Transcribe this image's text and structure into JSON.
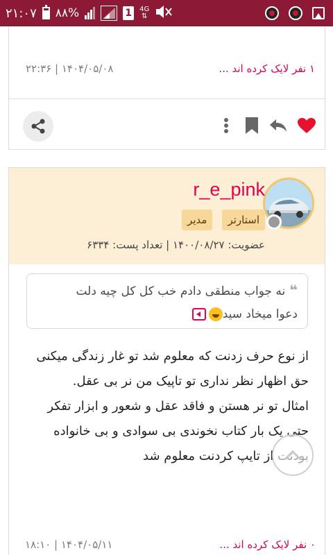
{
  "status_bar": {
    "time": "۲۱:۰۷",
    "battery_percent": "۸۸%",
    "sim_slot": "1",
    "network": "4G"
  },
  "post1": {
    "likes_text": "۱ نفر لایک کرده اند ...",
    "date": "۲۲:۳۶ | ۱۴۰۴/۰۵/۰۸"
  },
  "post2": {
    "username": "r_e_pink",
    "badges": [
      "استارتر",
      "مدیر"
    ],
    "member_info": "عضویت: ۱۴۰۰/۰۸/۲۷ | تعداد پست: ۶۳۳۴",
    "quote": {
      "line1": "نه جواب منطقی دادم خب کل کل چیه دلت",
      "line2": "دعوا میخاد سید"
    },
    "body_lines": [
      "از نوع حرف زدنت که معلوم شد تو غار زندگی میکنی",
      "حق اظهار نظر نداری تو تاپیک من نر بی عقل.",
      "امثال تو نر هستن و فاقد عقل و شعور و ابزار تفکر",
      "حتی یک بار کتاب نخوندی بی سوادی و بی خانواده بودنت از تایپ کردنت معلوم شد"
    ],
    "likes_text": "۰ نفر لایک کرده اند ...",
    "date": "۱۸:۱۰ | ۱۴۰۴/۰۵/۱۱"
  },
  "colors": {
    "status_bar": "#8c1a36",
    "accent_pink": "#e4004f",
    "header_bg": "#fdeed6",
    "badge_bg": "#f7d79a"
  }
}
